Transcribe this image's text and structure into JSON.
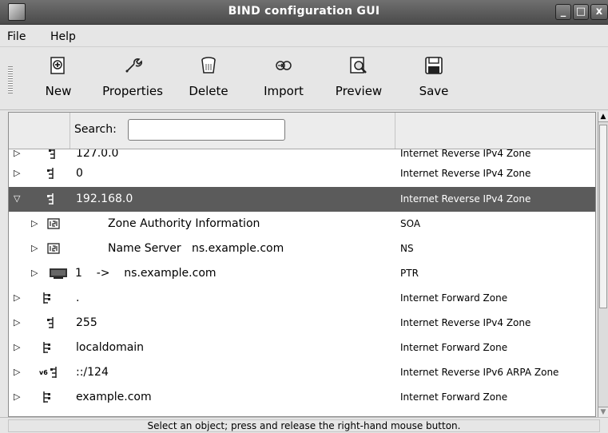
{
  "window": {
    "title": "BIND configuration GUI",
    "minimize": "_",
    "maximize": "□",
    "close": "x"
  },
  "menu": [
    {
      "label": "File"
    },
    {
      "label": "Help"
    }
  ],
  "toolbar": {
    "new": "New",
    "properties": "Properties",
    "delete": "Delete",
    "import": "Import",
    "preview": "Preview",
    "save": "Save"
  },
  "search": {
    "label": "Search:",
    "value": ""
  },
  "rows": [
    {
      "name": "127.0.0",
      "type": "Internet Reverse IPv4 Zone",
      "expander": "▷",
      "icon": "reverse-zone-icon"
    },
    {
      "name": "0",
      "type": "Internet Reverse IPv4 Zone",
      "expander": "▷",
      "icon": "reverse-zone-icon"
    },
    {
      "name": "192.168.0",
      "type": "Internet Reverse IPv4 Zone",
      "expander": "▽",
      "icon": "reverse-zone-icon",
      "selected": true
    },
    {
      "name": "Zone Authority Information",
      "type": "SOA",
      "expander": "▷",
      "icon": "record-icon"
    },
    {
      "name": "Name Server   ns.example.com",
      "type": "NS",
      "expander": "▷",
      "icon": "record-icon"
    },
    {
      "name": "1    ->    ns.example.com",
      "type": "PTR",
      "expander": "▷",
      "icon": "host-icon"
    },
    {
      "name": ".",
      "type": "Internet Forward Zone",
      "expander": "▷",
      "icon": "forward-zone-icon"
    },
    {
      "name": "255",
      "type": "Internet Reverse IPv4 Zone",
      "expander": "▷",
      "icon": "reverse-zone-icon"
    },
    {
      "name": "localdomain",
      "type": "Internet Forward Zone",
      "expander": "▷",
      "icon": "forward-zone-icon"
    },
    {
      "name": "::/124",
      "type": "Internet Reverse IPv6 ARPA Zone",
      "expander": "▷",
      "icon": "ipv6-zone-icon",
      "icon_text": "v6"
    },
    {
      "name": "example.com",
      "type": "Internet Forward Zone",
      "expander": "▷",
      "icon": "forward-zone-icon"
    }
  ],
  "status": "Select an object; press and release the right-hand mouse button.",
  "colors": {
    "selected_row": "#5b5b5b",
    "titlebar": "#4a4a4a"
  }
}
